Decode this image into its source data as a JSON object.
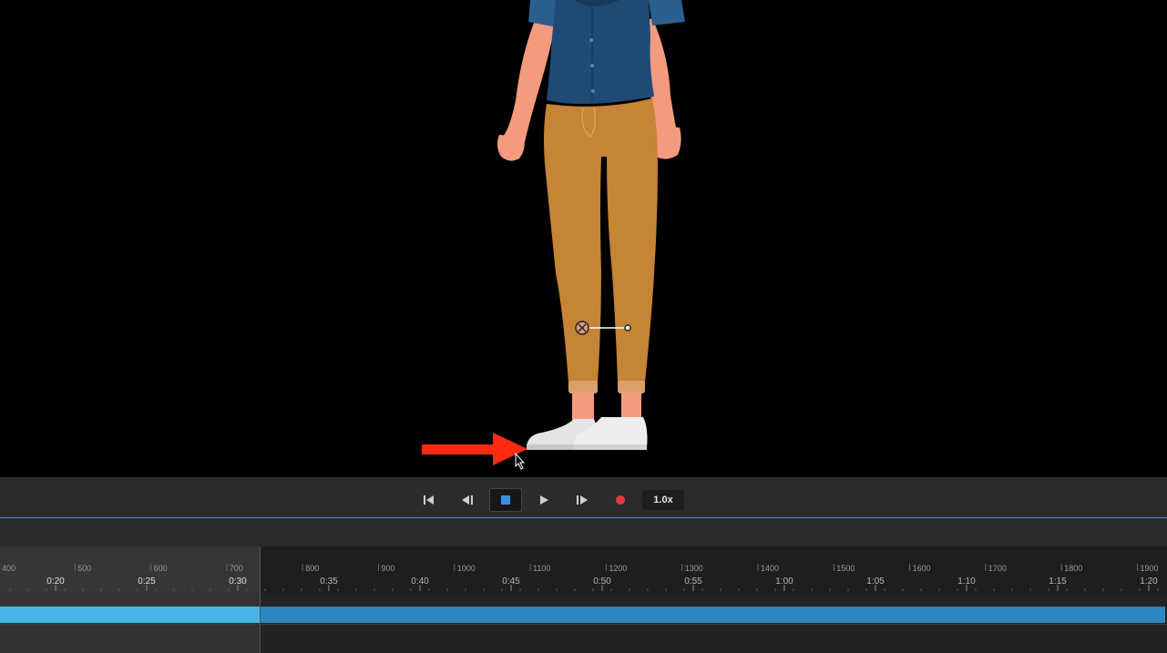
{
  "transport": {
    "speed_label": "1.0x"
  },
  "ruler": {
    "frame_labels": [
      "400",
      "500",
      "600",
      "700",
      "800",
      "900",
      "1000",
      "1100",
      "1200",
      "1300",
      "1400",
      "1500",
      "1600",
      "1700",
      "1800",
      "1900"
    ],
    "time_labels": [
      "0:20",
      "0:25",
      "0:30",
      "0:35",
      "0:40",
      "0:45",
      "0:50",
      "0:55",
      "1:00",
      "1:05",
      "1:10",
      "1:15",
      "1:20"
    ]
  },
  "colors": {
    "accent": "#3d8fd1",
    "clip_selected": "#45b5ea",
    "clip": "#2d86bf",
    "record": "#e23b3b",
    "annotation_arrow": "#ff2a12"
  }
}
